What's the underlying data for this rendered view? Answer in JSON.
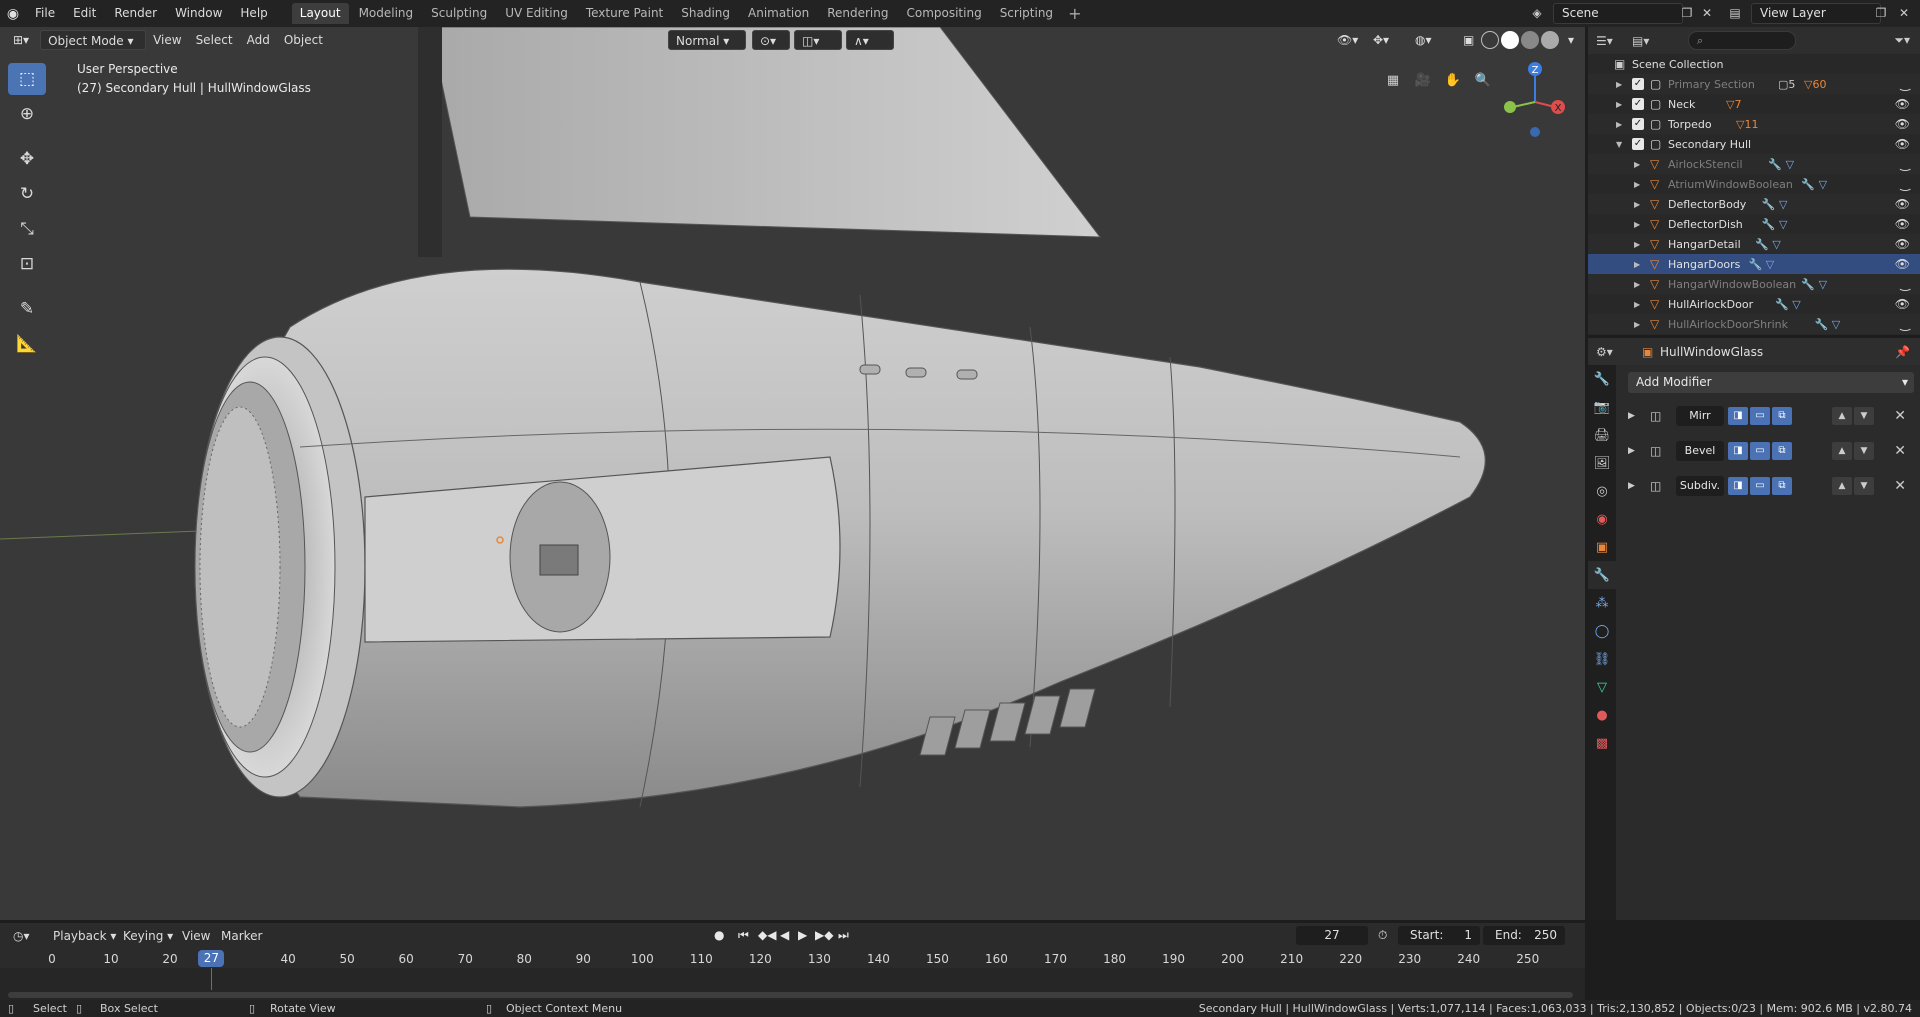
{
  "topbar": {
    "menu": [
      "File",
      "Edit",
      "Render",
      "Window",
      "Help"
    ],
    "workspaces": [
      "Layout",
      "Modeling",
      "Sculpting",
      "UV Editing",
      "Texture Paint",
      "Shading",
      "Animation",
      "Rendering",
      "Compositing",
      "Scripting"
    ],
    "active_workspace": "Layout",
    "add_workspace": "+",
    "scene": "Scene",
    "view_layer": "View Layer"
  },
  "viewport": {
    "mode": "Object Mode",
    "menus": [
      "View",
      "Select",
      "Add",
      "Object"
    ],
    "orientation": "Normal",
    "perspective_label": "User Perspective",
    "object_label": "(27) Secondary Hull | HullWindowGlass",
    "gizmo_axes": {
      "z": "Z",
      "x": "X"
    }
  },
  "outliner": {
    "search_placeholder": "",
    "rows": [
      {
        "label": "Scene Collection",
        "type": "scene",
        "indent": 0
      },
      {
        "label": "Primary Section",
        "type": "collection",
        "indent": 1,
        "dim": true,
        "badge_a": "5",
        "badge_b": "60"
      },
      {
        "label": "Neck",
        "type": "collection",
        "indent": 1,
        "badge_b": "7"
      },
      {
        "label": "Torpedo",
        "type": "collection",
        "indent": 1,
        "badge_b": "11"
      },
      {
        "label": "Secondary Hull",
        "type": "collection",
        "indent": 1,
        "expanded": true
      },
      {
        "label": "AirlockStencil",
        "type": "object",
        "indent": 2,
        "dim": true
      },
      {
        "label": "AtriumWindowBoolean",
        "type": "object",
        "indent": 2,
        "dim": true
      },
      {
        "label": "DeflectorBody",
        "type": "object",
        "indent": 2
      },
      {
        "label": "DeflectorDish",
        "type": "object",
        "indent": 2
      },
      {
        "label": "HangarDetail",
        "type": "object",
        "indent": 2
      },
      {
        "label": "HangarDoors",
        "type": "object",
        "indent": 2,
        "selected": true
      },
      {
        "label": "HangarWindowBoolean",
        "type": "object",
        "indent": 2,
        "dim": true
      },
      {
        "label": "HullAirlockDoor",
        "type": "object",
        "indent": 2
      },
      {
        "label": "HullAirlockDoorShrink",
        "type": "object",
        "indent": 2,
        "dim": true
      }
    ]
  },
  "properties": {
    "object_name": "HullWindowGlass",
    "add_modifier": "Add Modifier",
    "modifiers": [
      {
        "name": "Mirr",
        "icon": "mirror-icon"
      },
      {
        "name": "Bevel",
        "icon": "bevel-icon"
      },
      {
        "name": "Subdiv.",
        "icon": "subdivision-icon"
      }
    ]
  },
  "timeline": {
    "menus": [
      "Playback",
      "Keying",
      "View",
      "Marker"
    ],
    "current_frame": "27",
    "start_label": "Start:",
    "start": "1",
    "end_label": "End:",
    "end": "250",
    "ticks": [
      0,
      10,
      20,
      30,
      40,
      50,
      60,
      70,
      80,
      90,
      100,
      110,
      120,
      130,
      140,
      150,
      160,
      170,
      180,
      190,
      200,
      210,
      220,
      230,
      240,
      250
    ]
  },
  "statusbar": {
    "select": "Select",
    "box_select": "Box Select",
    "rotate": "Rotate View",
    "context_menu": "Object Context Menu",
    "stats": "Secondary Hull | HullWindowGlass | Verts:1,077,114 | Faces:1,063,033 | Tris:2,130,852 | Objects:0/23 | Mem: 902.6 MB | v2.80.74"
  },
  "colors": {
    "accent": "#4a72b5",
    "selection": "#334d80",
    "object_icon": "#e8873a",
    "mesh_icon": "#3dd8b4",
    "modifier_icon": "#7aaae8"
  }
}
